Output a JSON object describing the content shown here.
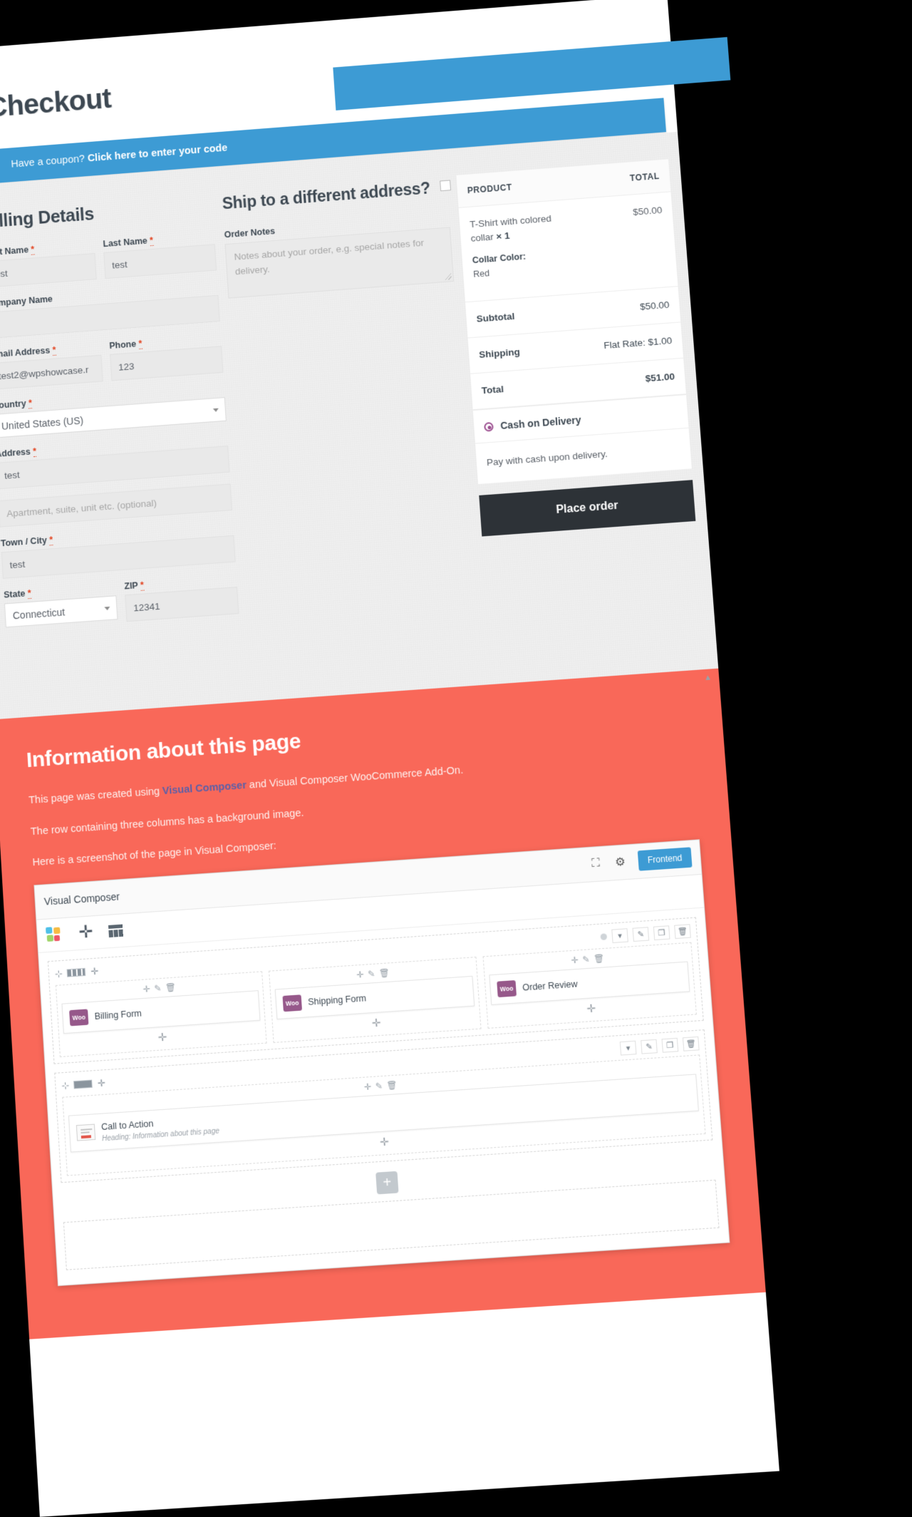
{
  "header": {
    "title": "Checkout"
  },
  "coupon": {
    "lead": "Have a coupon? ",
    "link": "Click here to enter your code"
  },
  "billing": {
    "heading": "Billing Details",
    "fields": [
      {
        "label": "First Name",
        "required": true,
        "value": "test",
        "placeholder": ""
      },
      {
        "label": "Last Name",
        "required": true,
        "value": "test",
        "placeholder": ""
      },
      {
        "label": "Company Name",
        "required": false,
        "value": "",
        "placeholder": ""
      },
      {
        "label": "Email Address",
        "required": true,
        "value": "test2@wpshowcase.r",
        "placeholder": ""
      },
      {
        "label": "Phone",
        "required": true,
        "value": "123",
        "placeholder": ""
      },
      {
        "label": "Country",
        "required": true,
        "value": "United States (US)",
        "placeholder": ""
      },
      {
        "label": "Address",
        "required": true,
        "value": "test",
        "placeholder": ""
      },
      {
        "label": "",
        "required": false,
        "value": "",
        "placeholder": "Apartment, suite, unit etc. (optional)"
      },
      {
        "label": "Town / City",
        "required": true,
        "value": "test",
        "placeholder": ""
      },
      {
        "label": "State",
        "required": true,
        "value": "Connecticut",
        "placeholder": ""
      },
      {
        "label": "ZIP",
        "required": true,
        "value": "12341",
        "placeholder": ""
      }
    ]
  },
  "shipping": {
    "heading": "Ship to a different address?",
    "checkbox_checked": false,
    "notes_label": "Order Notes",
    "notes_value": "",
    "notes_placeholder": "Notes about your order, e.g. special notes for delivery."
  },
  "order": {
    "col_product": "PRODUCT",
    "col_total": "TOTAL",
    "items": [
      {
        "name": "T-Shirt with colored collar",
        "qty": "× 1",
        "total": "$50.00",
        "variation_label": "Collar Color:",
        "variation_value": "Red"
      }
    ],
    "totals": [
      {
        "label": "Subtotal",
        "value": "$50.00"
      },
      {
        "label": "Shipping",
        "value": "Flat Rate: $1.00"
      },
      {
        "label": "Total",
        "value": "$51.00"
      }
    ],
    "payment_method": "Cash on Delivery",
    "payment_description": "Pay with cash upon delivery.",
    "place_order_label": "Place order"
  },
  "info": {
    "title": "Information about this page",
    "line1_pre": "This page was created  using ",
    "line1_link": "Visual Composer",
    "line1_post": " and Visual Composer WooCommerce Add-On.",
    "line2": "The row containing three columns has a background image.",
    "line3": "Here is a screenshot of the page in Visual Composer:"
  },
  "vc": {
    "app_name": "Visual Composer",
    "fullscreen_icon": "expand-icon",
    "settings_icon": "gear-icon",
    "frontend_label": "Frontend",
    "logo_icon": "visual-composer-logo-icon",
    "add_element_icon": "plus-icon",
    "templates_icon": "grid-icon",
    "row1": {
      "columns": [
        {
          "element": "Billing Form",
          "badge": "Woo"
        },
        {
          "element": "Shipping Form",
          "badge": "Woo"
        },
        {
          "element": "Order Review",
          "badge": "Woo"
        }
      ]
    },
    "row2": {
      "element": "Call to Action",
      "element_sub": "Heading: Information about this page"
    },
    "controls": {
      "drag": "⊹",
      "toggle": "▾",
      "edit": "✎",
      "clone": "❐",
      "delete": "🗑",
      "plus": "✛"
    }
  }
}
